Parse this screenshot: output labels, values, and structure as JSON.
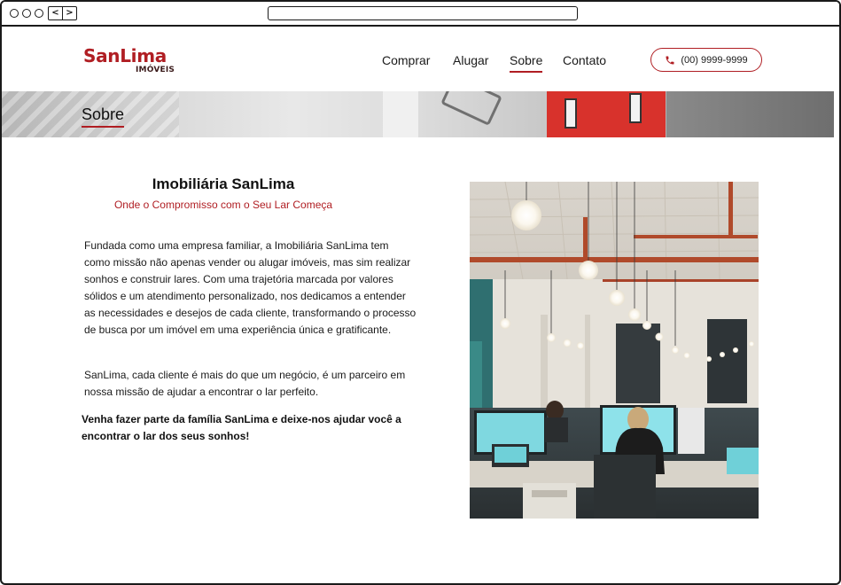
{
  "browser": {
    "nav_back": "<",
    "nav_forward": ">"
  },
  "header": {
    "logo_main": "SanLima",
    "logo_sub": "IMÓVEIS",
    "nav": [
      {
        "label": "Comprar",
        "active": false
      },
      {
        "label": "Alugar",
        "active": false
      },
      {
        "label": "Sobre",
        "active": true
      },
      {
        "label": "Contato",
        "active": false
      }
    ],
    "phone": "(00) 9999-9999"
  },
  "banner": {
    "title": "Sobre"
  },
  "content": {
    "heading": "Imobiliária SanLima",
    "subheading": "Onde o Compromisso com o Seu Lar Começa",
    "paragraphs": [
      "Fundada como uma empresa familiar, a Imobiliária SanLima tem como missão não apenas vender ou alugar imóveis, mas sim realizar sonhos e construir lares. Com uma trajetória marcada por valores sólidos e um atendimento personalizado, nos dedicamos a entender as necessidades e desejos de cada cliente, transformando o processo de busca por um imóvel em uma experiência única e gratificante.",
      "SanLima, cada cliente é mais do que um negócio, é um parceiro em nossa missão de ajudar a encontrar o lar perfeito.",
      "Venha fazer parte da família SanLima e deixe-nos ajudar você a encontrar o lar dos seus sonhos!"
    ]
  },
  "colors": {
    "brand": "#b01e23",
    "text": "#1a1a1a"
  },
  "icons": {
    "phone": "phone-icon"
  }
}
